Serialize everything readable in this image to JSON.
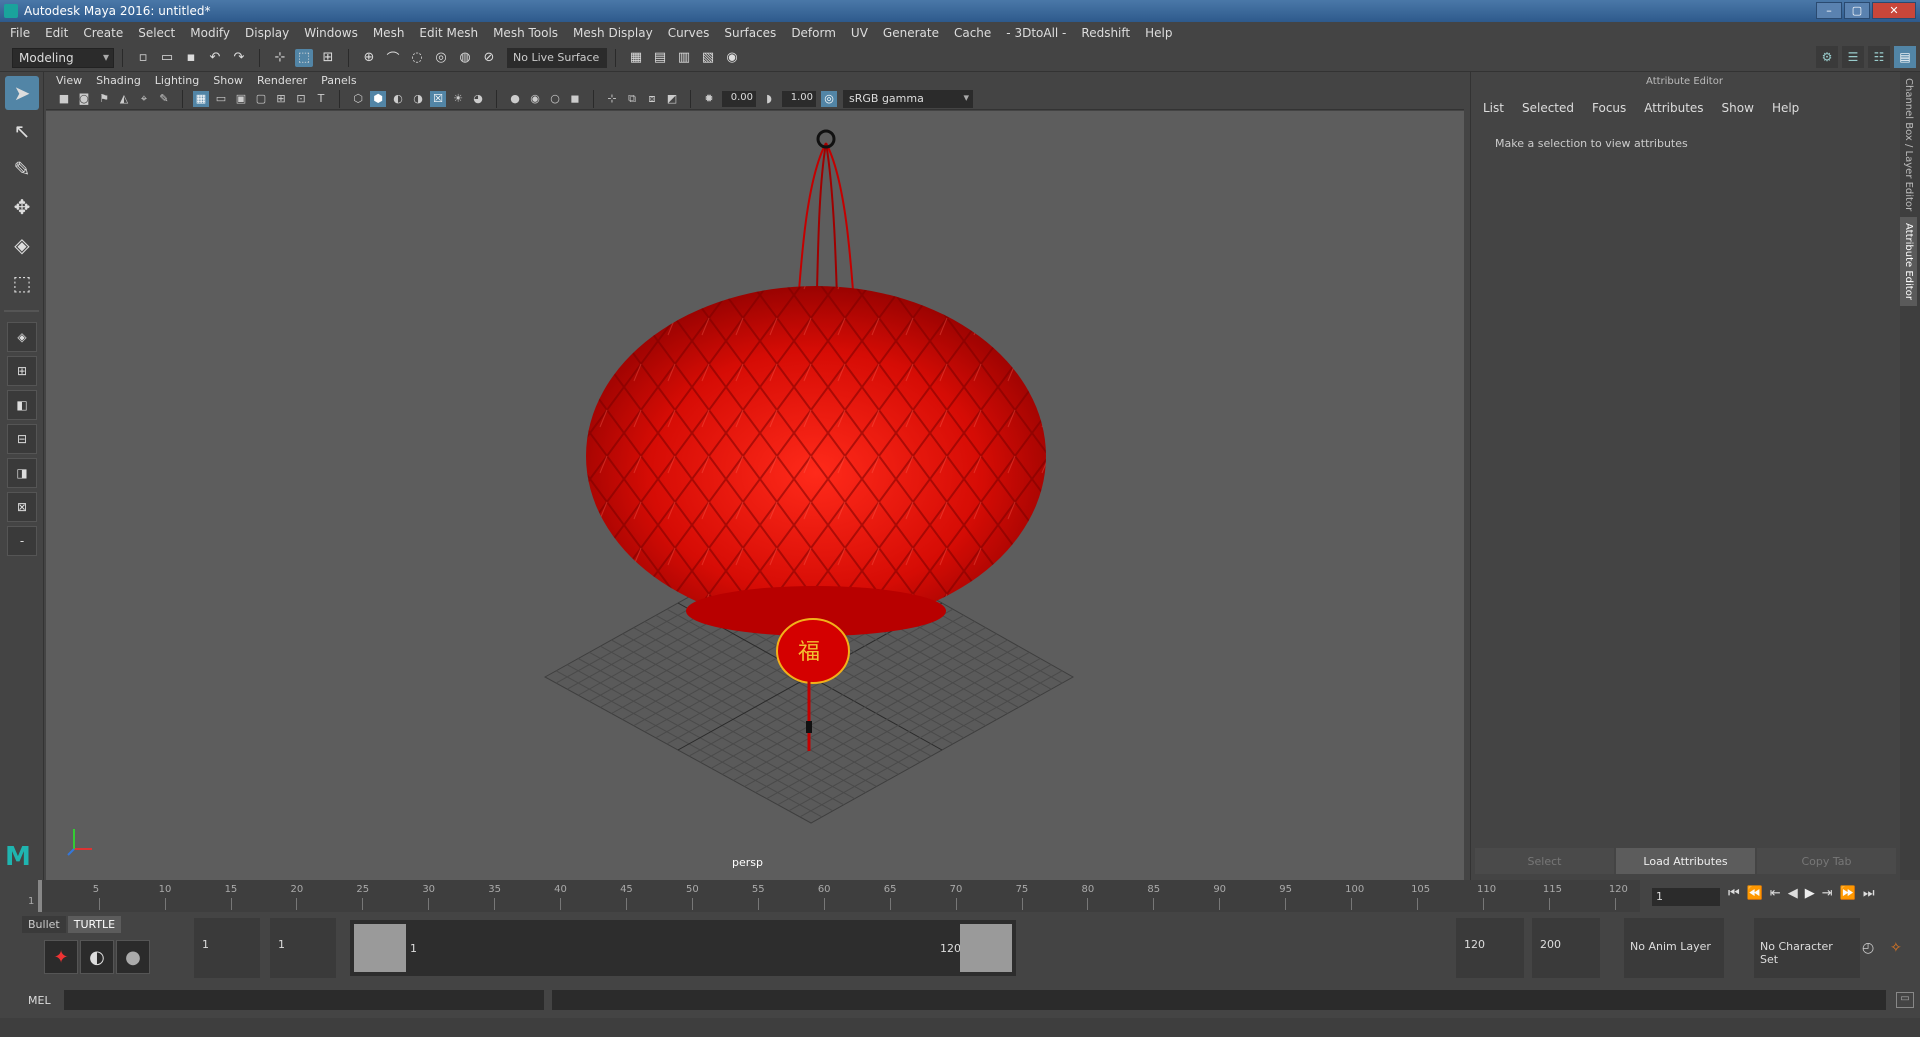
{
  "window": {
    "title": "Autodesk Maya 2016: untitled*"
  },
  "menubar": [
    "File",
    "Edit",
    "Create",
    "Select",
    "Modify",
    "Display",
    "Windows",
    "Mesh",
    "Edit Mesh",
    "Mesh Tools",
    "Mesh Display",
    "Curves",
    "Surfaces",
    "Deform",
    "UV",
    "Generate",
    "Cache",
    "- 3DtoAll -",
    "Redshift",
    "Help"
  ],
  "shelf": {
    "mode": "Modeling",
    "live_surface": "No Live Surface"
  },
  "viewport": {
    "menu": [
      "View",
      "Shading",
      "Lighting",
      "Show",
      "Renderer",
      "Panels"
    ],
    "exposure": "0.00",
    "gamma_value": "1.00",
    "color_space": "sRGB gamma",
    "camera": "persp"
  },
  "attribute_editor": {
    "title": "Attribute Editor",
    "menu": [
      "List",
      "Selected",
      "Focus",
      "Attributes",
      "Show",
      "Help"
    ],
    "message": "Make a selection to view attributes",
    "buttons": {
      "select": "Select",
      "load": "Load Attributes",
      "copy": "Copy Tab"
    }
  },
  "side_tabs": {
    "channel_box": "Channel Box / Layer Editor",
    "attribute_editor": "Attribute Editor"
  },
  "timeline": {
    "ticks": [
      "5",
      "10",
      "15",
      "20",
      "25",
      "30",
      "35",
      "40",
      "45",
      "50",
      "55",
      "60",
      "65",
      "70",
      "75",
      "80",
      "85",
      "90",
      "95",
      "100",
      "105",
      "110",
      "115",
      "120"
    ],
    "start_label": "1",
    "current_frame": "1"
  },
  "range": {
    "shelf_tabs": {
      "bullet": "Bullet",
      "turtle": "TURTLE"
    },
    "start": "1",
    "playback_start": "1",
    "slider_start": "1",
    "slider_end": "120",
    "playback_end": "120",
    "end": "200",
    "anim_layer": "No Anim Layer",
    "character_set": "No Character Set"
  },
  "mel": {
    "label": "MEL"
  }
}
